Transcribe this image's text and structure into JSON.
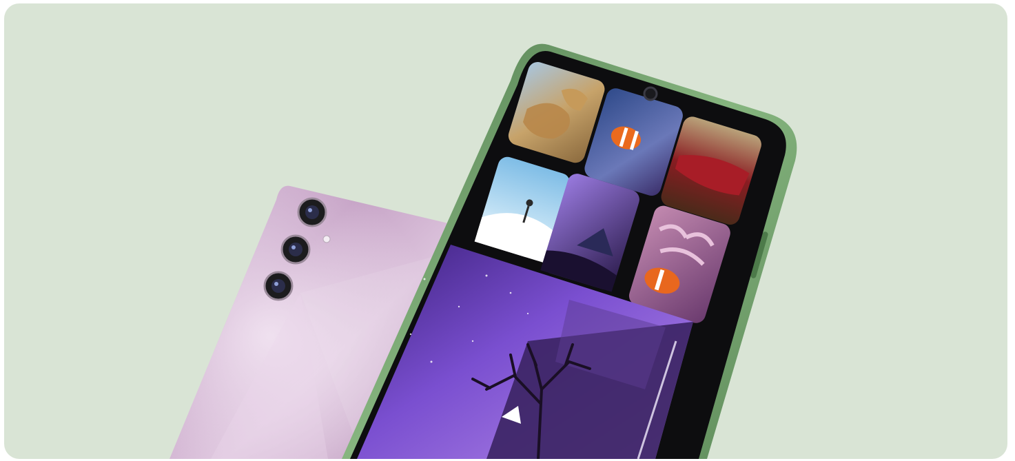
{
  "banner": {
    "background_color": "#d9e4d5",
    "corner": "rounded"
  },
  "rear_phone": {
    "color_name": "lavender",
    "body_color": "#c8a9c9",
    "camera_count": 3,
    "has_flash": true
  },
  "front_phone": {
    "frame_color": "#6f9b6a",
    "notch": "teardrop",
    "tiles": [
      {
        "name": "lion-cubs-photo",
        "accent": "#b9925a"
      },
      {
        "name": "clownfish-anemone-photo",
        "accent": "#e3661f"
      },
      {
        "name": "red-fabric-texture-photo",
        "accent": "#9b1c23"
      },
      {
        "name": "snowy-hill-illustration",
        "accent": "#8fc7e8"
      },
      {
        "name": "night-tent-photo",
        "accent": "#6b4fb8"
      },
      {
        "name": "clownfish-pink-anemone-photo",
        "accent": "#e06a24"
      }
    ],
    "video": {
      "name": "starry-night-tree-video",
      "accent": "#6a3fc0",
      "has_play_icon": true
    }
  }
}
